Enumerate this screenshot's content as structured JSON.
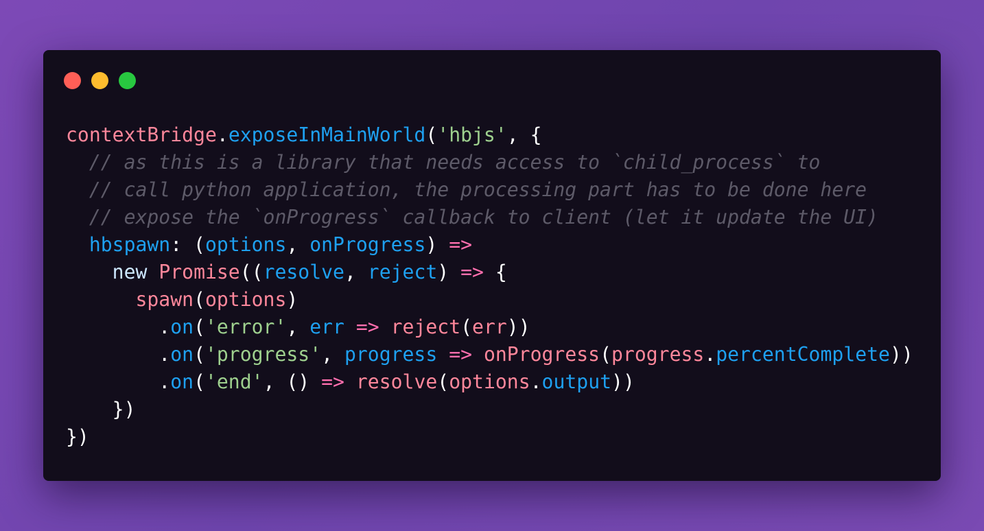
{
  "colors": {
    "background": "#7a4ab3",
    "window": "#120d1b",
    "close": "#ff5f57",
    "minimize": "#febc2e",
    "maximize": "#28c840"
  },
  "window_controls": [
    {
      "name": "close-dot",
      "color": "#ff5f57"
    },
    {
      "name": "minimize-dot",
      "color": "#febc2e"
    },
    {
      "name": "maximize-dot",
      "color": "#28c840"
    }
  ],
  "code_lines": [
    [
      {
        "text": "contextBridge",
        "kind": "pink"
      },
      {
        "text": ".",
        "kind": "white"
      },
      {
        "text": "exposeInMainWorld",
        "kind": "blue"
      },
      {
        "text": "(",
        "kind": "white"
      },
      {
        "text": "'hbjs'",
        "kind": "green"
      },
      {
        "text": ", {",
        "kind": "white"
      }
    ],
    [
      {
        "text": "  // as this is a library that needs access to `child_process` to",
        "kind": "comment"
      }
    ],
    [
      {
        "text": "  // call python application, the processing part has to be done here",
        "kind": "comment"
      }
    ],
    [
      {
        "text": "  // expose the `onProgress` callback to client (let it update the UI)",
        "kind": "comment"
      }
    ],
    [
      {
        "text": "  ",
        "kind": "white"
      },
      {
        "text": "hbspawn",
        "kind": "blue"
      },
      {
        "text": ": (",
        "kind": "white"
      },
      {
        "text": "options",
        "kind": "blue"
      },
      {
        "text": ", ",
        "kind": "white"
      },
      {
        "text": "onProgress",
        "kind": "blue"
      },
      {
        "text": ") ",
        "kind": "white"
      },
      {
        "text": "=>",
        "kind": "op"
      }
    ],
    [
      {
        "text": "    ",
        "kind": "white"
      },
      {
        "text": "new",
        "kind": "light"
      },
      {
        "text": " ",
        "kind": "white"
      },
      {
        "text": "Promise",
        "kind": "pink"
      },
      {
        "text": "((",
        "kind": "white"
      },
      {
        "text": "resolve",
        "kind": "blue"
      },
      {
        "text": ", ",
        "kind": "white"
      },
      {
        "text": "reject",
        "kind": "blue"
      },
      {
        "text": ") ",
        "kind": "white"
      },
      {
        "text": "=>",
        "kind": "op"
      },
      {
        "text": " {",
        "kind": "white"
      }
    ],
    [
      {
        "text": "      ",
        "kind": "white"
      },
      {
        "text": "spawn",
        "kind": "pink"
      },
      {
        "text": "(",
        "kind": "white"
      },
      {
        "text": "options",
        "kind": "pink"
      },
      {
        "text": ")",
        "kind": "white"
      }
    ],
    [
      {
        "text": "        .",
        "kind": "white"
      },
      {
        "text": "on",
        "kind": "blue"
      },
      {
        "text": "(",
        "kind": "white"
      },
      {
        "text": "'error'",
        "kind": "green"
      },
      {
        "text": ", ",
        "kind": "white"
      },
      {
        "text": "err",
        "kind": "blue"
      },
      {
        "text": " ",
        "kind": "white"
      },
      {
        "text": "=>",
        "kind": "op"
      },
      {
        "text": " ",
        "kind": "white"
      },
      {
        "text": "reject",
        "kind": "pink"
      },
      {
        "text": "(",
        "kind": "white"
      },
      {
        "text": "err",
        "kind": "pink"
      },
      {
        "text": "))",
        "kind": "white"
      }
    ],
    [
      {
        "text": "        .",
        "kind": "white"
      },
      {
        "text": "on",
        "kind": "blue"
      },
      {
        "text": "(",
        "kind": "white"
      },
      {
        "text": "'progress'",
        "kind": "green"
      },
      {
        "text": ", ",
        "kind": "white"
      },
      {
        "text": "progress",
        "kind": "blue"
      },
      {
        "text": " ",
        "kind": "white"
      },
      {
        "text": "=>",
        "kind": "op"
      },
      {
        "text": " ",
        "kind": "white"
      },
      {
        "text": "onProgress",
        "kind": "pink"
      },
      {
        "text": "(",
        "kind": "white"
      },
      {
        "text": "progress",
        "kind": "pink"
      },
      {
        "text": ".",
        "kind": "white"
      },
      {
        "text": "percentComplete",
        "kind": "blue"
      },
      {
        "text": "))",
        "kind": "white"
      }
    ],
    [
      {
        "text": "        .",
        "kind": "white"
      },
      {
        "text": "on",
        "kind": "blue"
      },
      {
        "text": "(",
        "kind": "white"
      },
      {
        "text": "'end'",
        "kind": "green"
      },
      {
        "text": ", () ",
        "kind": "white"
      },
      {
        "text": "=>",
        "kind": "op"
      },
      {
        "text": " ",
        "kind": "white"
      },
      {
        "text": "resolve",
        "kind": "pink"
      },
      {
        "text": "(",
        "kind": "white"
      },
      {
        "text": "options",
        "kind": "pink"
      },
      {
        "text": ".",
        "kind": "white"
      },
      {
        "text": "output",
        "kind": "blue"
      },
      {
        "text": "))",
        "kind": "white"
      }
    ],
    [
      {
        "text": "    })",
        "kind": "white"
      }
    ],
    [
      {
        "text": "})",
        "kind": "white"
      }
    ]
  ]
}
